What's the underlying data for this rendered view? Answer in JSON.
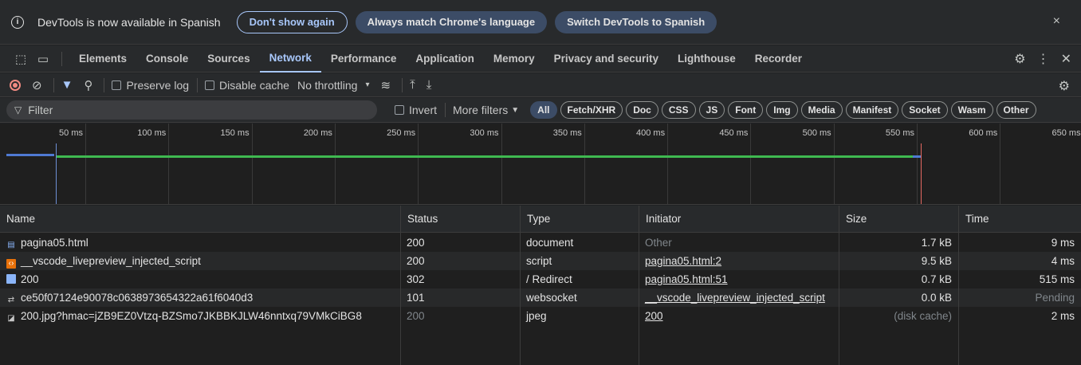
{
  "infobar": {
    "message": "DevTools is now available in Spanish",
    "buttons": [
      "Don't show again",
      "Always match Chrome's language",
      "Switch DevTools to Spanish"
    ],
    "close": "×"
  },
  "tabs": {
    "items": [
      "Elements",
      "Console",
      "Sources",
      "Network",
      "Performance",
      "Application",
      "Memory",
      "Privacy and security",
      "Lighthouse",
      "Recorder"
    ],
    "active": "Network"
  },
  "toolbar": {
    "preserve_log": "Preserve log",
    "disable_cache": "Disable cache",
    "throttling": "No throttling"
  },
  "filter": {
    "placeholder": "Filter",
    "invert": "Invert",
    "more_filters": "More filters",
    "chips": [
      "All",
      "Fetch/XHR",
      "Doc",
      "CSS",
      "JS",
      "Font",
      "Img",
      "Media",
      "Manifest",
      "Socket",
      "Wasm",
      "Other"
    ],
    "selected_chip": "All"
  },
  "timeline": {
    "ticks": [
      "50 ms",
      "100 ms",
      "150 ms",
      "200 ms",
      "250 ms",
      "300 ms",
      "350 ms",
      "400 ms",
      "450 ms",
      "500 ms",
      "550 ms",
      "600 ms",
      "650 ms"
    ]
  },
  "table": {
    "columns": [
      "Name",
      "Status",
      "Type",
      "Initiator",
      "Size",
      "Time"
    ],
    "rows": [
      {
        "icon": "document-icon",
        "name": "pagina05.html",
        "status": "200",
        "type": "document",
        "initiator": "Other",
        "initiator_link": false,
        "size": "1.7 kB",
        "time": "9 ms"
      },
      {
        "icon": "script-icon",
        "name": "__vscode_livepreview_injected_script",
        "status": "200",
        "type": "script",
        "initiator": "pagina05.html:2",
        "initiator_link": true,
        "size": "9.5 kB",
        "time": "4 ms"
      },
      {
        "icon": "image-icon",
        "name": "200",
        "status": "302",
        "type": "/ Redirect",
        "initiator": "pagina05.html:51",
        "initiator_link": true,
        "size": "0.7 kB",
        "time": "515 ms"
      },
      {
        "icon": "websocket-icon",
        "name": "ce50f07124e90078c0638973654322a61f6040d3",
        "status": "101",
        "type": "websocket",
        "initiator": "__vscode_livepreview_injected_script",
        "initiator_link": true,
        "size": "0.0 kB",
        "time": "Pending"
      },
      {
        "icon": "jpeg-icon",
        "name": "200.jpg?hmac=jZB9EZ0Vtzq-BZSmo7JKBBKJLW46nntxq79VMkCiBG8",
        "status": "200",
        "type": "jpeg",
        "initiator": "200",
        "initiator_link": true,
        "size": "(disk cache)",
        "time": "2 ms"
      }
    ]
  }
}
